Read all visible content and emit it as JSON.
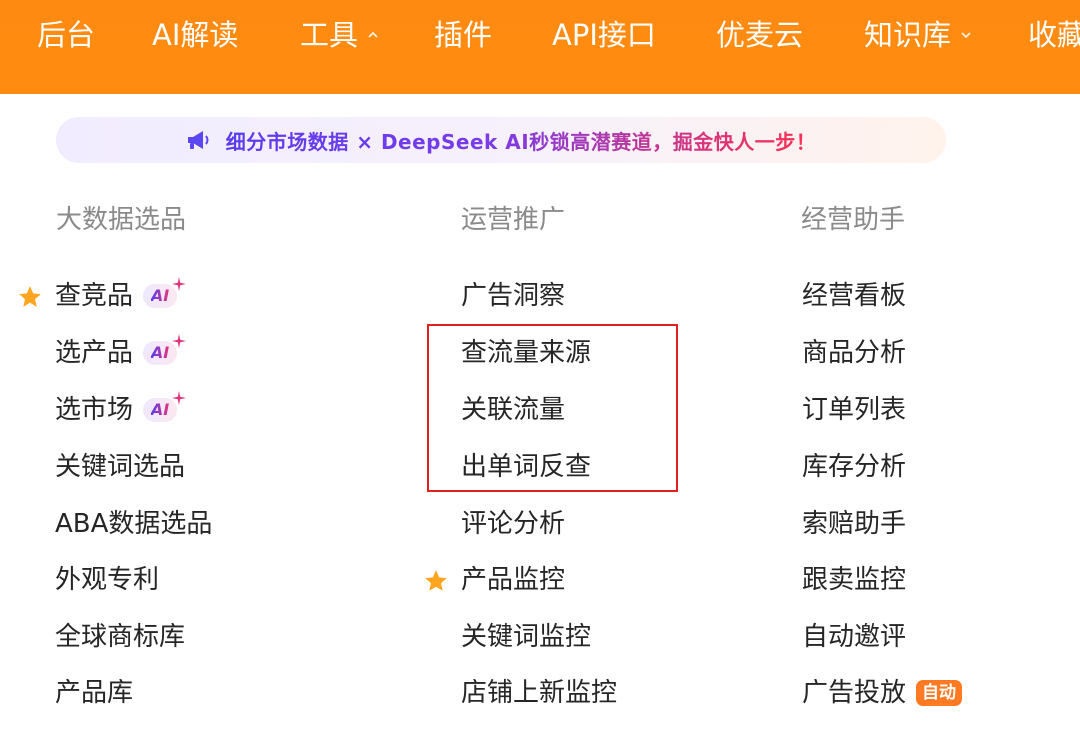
{
  "nav": {
    "items": [
      {
        "label": "后台"
      },
      {
        "label": "AI解读"
      },
      {
        "label": "工具"
      },
      {
        "label": "插件"
      },
      {
        "label": "API接口"
      },
      {
        "label": "优麦云"
      },
      {
        "label": "知识库"
      },
      {
        "label": "收藏"
      }
    ]
  },
  "banner": {
    "text": "细分市场数据 × DeepSeek AI秒锁高潜赛道，掘金快人一步！",
    "icon": "megaphone-icon"
  },
  "columns": [
    {
      "title": "大数据选品",
      "items": [
        {
          "label": "查竞品",
          "badge": "AI"
        },
        {
          "label": "选产品",
          "badge": "AI"
        },
        {
          "label": "选市场",
          "badge": "AI"
        },
        {
          "label": "关键词选品"
        },
        {
          "label": "ABA数据选品"
        },
        {
          "label": "外观专利"
        },
        {
          "label": "全球商标库"
        },
        {
          "label": "产品库"
        }
      ]
    },
    {
      "title": "运营推广",
      "items": [
        {
          "label": "广告洞察"
        },
        {
          "label": "查流量来源"
        },
        {
          "label": "关联流量"
        },
        {
          "label": "出单词反查"
        },
        {
          "label": "评论分析"
        },
        {
          "label": "产品监控"
        },
        {
          "label": "关键词监控"
        },
        {
          "label": "店铺上新监控"
        }
      ]
    },
    {
      "title": "经营助手",
      "items": [
        {
          "label": "经营看板"
        },
        {
          "label": "商品分析"
        },
        {
          "label": "订单列表"
        },
        {
          "label": "库存分析"
        },
        {
          "label": "索赔助手"
        },
        {
          "label": "跟卖监控"
        },
        {
          "label": "自动邀评"
        },
        {
          "label": "广告投放",
          "badge": "自动"
        }
      ]
    }
  ],
  "colors": {
    "nav_bg": "#ff8c10",
    "star": "#ffa51f",
    "highlight_border": "#e02020",
    "auto_badge": "#ff7a22"
  }
}
